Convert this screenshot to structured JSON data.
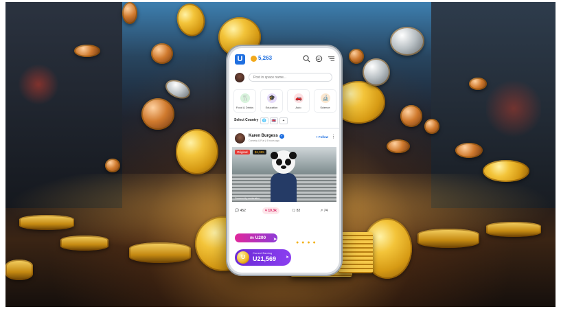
{
  "app": {
    "logo_letter": "U",
    "brand_color": "#1f6fe0",
    "balance": "5,263"
  },
  "header_icons": [
    "search-icon",
    "chat-icon",
    "menu-icon"
  ],
  "composer": {
    "placeholder": "Post in space name..."
  },
  "categories": [
    {
      "label": "Food & Drinks",
      "icon": "🍴",
      "color": "#d8f3dc"
    },
    {
      "label": "Education",
      "icon": "🎓",
      "color": "#e6dcfa"
    },
    {
      "label": "Auto",
      "icon": "🚗",
      "color": "#fde0e3"
    },
    {
      "label": "Science",
      "icon": "🔬",
      "color": "#fbe7cf"
    }
  ],
  "country": {
    "label": "Select Country",
    "flags": [
      "🌐",
      "🇬🇧",
      "+"
    ]
  },
  "post": {
    "author": "Karen Burgess",
    "meta": "Comedy & Fun  |  4 hours ago",
    "follow_label": "+ Follow",
    "badge_original": "Original",
    "badge_price": "$1,995",
    "moderation": "Community moderation",
    "stats": {
      "comments": "452",
      "likes": "10.3k",
      "replies": "82",
      "shares": "74"
    }
  },
  "earning_pill": {
    "amount": "m U200"
  },
  "current_earning": {
    "label": "Current Earning",
    "amount": "U21,569",
    "icon_letter": "U"
  }
}
